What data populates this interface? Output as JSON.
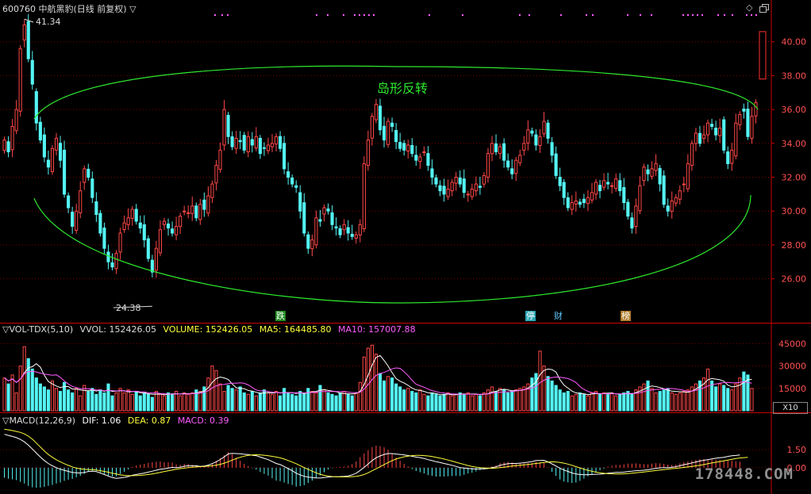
{
  "header": {
    "title": "600760 中航黑豹(日线 前复权) ▽",
    "icon_diamond": "◇",
    "icon_restore": "restore-window"
  },
  "annotation": {
    "text": "岛形反转"
  },
  "price_labels": {
    "high": "41.34",
    "low": "24.38"
  },
  "event_markers": [
    {
      "text": "跌",
      "bg": "#1f8a1f",
      "color": "#ffffff"
    },
    {
      "text": "停",
      "bg": "#2aa5b3",
      "color": "#ffffff"
    },
    {
      "text": "财",
      "bg": "#000000",
      "color": "#5ec8ff"
    },
    {
      "text": "榜",
      "bg": "#b07a28",
      "color": "#ffffff"
    }
  ],
  "volume_panel": {
    "name": "▽VOL-TDX(5,10)",
    "vvol": "VVOL: 152426.05",
    "volume": "VOLUME: 152426.05",
    "ma5": "MA5: 164485.80",
    "ma10": "MA10: 157007.88",
    "scale_button": "X10"
  },
  "macd_panel": {
    "name": "▽MACD(12,26,9)",
    "dif": "DIF: 1.06",
    "dea": "DEA: 0.87",
    "macd": "MACD: 0.39"
  },
  "watermark": "178448.COM",
  "colors": {
    "up": "#ff4747",
    "down": "#54f4f4",
    "ma5": "#ffffff",
    "ma10": "#ff5cff",
    "dif": "#ffffff",
    "dea": "#ffff3c",
    "ellipse": "#2ee82e",
    "grid": "#7a0000",
    "axis": "#cc0000"
  },
  "chart_data": [
    {
      "type": "candlestick",
      "title": "600760 中航黑豹(日线 前复权)",
      "y_ticks": [
        26.0,
        28.0,
        30.0,
        32.0,
        34.0,
        36.0,
        38.0,
        40.0
      ],
      "ylim": [
        23.5,
        42.0
      ],
      "grid": true,
      "marked_high": 41.34,
      "marked_low": 24.38,
      "close": [
        34.2,
        33.5,
        35.0,
        36.0,
        39.6,
        41.0,
        39.0,
        37.5,
        35.2,
        34.2,
        33.2,
        32.6,
        33.7,
        34.3,
        33.0,
        31.0,
        30.2,
        29.1,
        30.0,
        31.2,
        32.5,
        32.0,
        30.8,
        29.8,
        28.7,
        27.8,
        27.0,
        26.7,
        27.5,
        28.7,
        29.3,
        29.6,
        30.1,
        29.4,
        29.0,
        28.3,
        27.2,
        26.4,
        27.8,
        28.9,
        29.4,
        29.0,
        28.7,
        29.1,
        29.7,
        30.0,
        29.9,
        30.3,
        29.6,
        30.4,
        30.1,
        30.9,
        31.6,
        32.7,
        33.6,
        36.0,
        34.4,
        33.8,
        34.3,
        34.1,
        33.6,
        34.4,
        33.9,
        34.4,
        33.4,
        33.7,
        33.9,
        34.0,
        34.4,
        33.7,
        32.5,
        32.0,
        31.6,
        31.4,
        30.0,
        28.7,
        27.8,
        28.3,
        29.6,
        29.4,
        30.2,
        30.0,
        29.2,
        29.0,
        28.6,
        29.2,
        28.7,
        28.5,
        28.6,
        29.2,
        32.8,
        34.2,
        35.6,
        36.3,
        34.8,
        34.2,
        35.3,
        35.0,
        34.1,
        33.7,
        33.6,
        33.9,
        33.4,
        33.0,
        33.2,
        33.5,
        32.7,
        32.0,
        31.6,
        31.2,
        31.0,
        31.3,
        31.7,
        32.0,
        31.6,
        31.1,
        31.0,
        31.3,
        31.6,
        31.4,
        32.1,
        33.4,
        34.0,
        33.5,
        33.8,
        33.0,
        32.6,
        32.2,
        33.0,
        33.3,
        34.0,
        34.8,
        34.6,
        33.9,
        34.4,
        35.3,
        34.3,
        33.3,
        32.1,
        31.5,
        30.8,
        30.2,
        30.5,
        30.6,
        30.4,
        30.5,
        30.8,
        31.1,
        31.7,
        31.2,
        31.8,
        31.6,
        31.5,
        31.9,
        31.2,
        30.5,
        29.7,
        29.0,
        30.3,
        31.5,
        32.6,
        32.2,
        32.5,
        32.8,
        31.6,
        30.4,
        30.0,
        30.6,
        30.8,
        31.2,
        31.6,
        32.8,
        34.0,
        34.6,
        34.0,
        34.5,
        35.2,
        35.0,
        34.5,
        34.9,
        33.6,
        32.8,
        33.6,
        35.2,
        35.7,
        35.9,
        34.4,
        35.6,
        36.4
      ],
      "volume": {
        "y_ticks": [
          15000,
          30000,
          45000
        ],
        "values": [
          22000,
          18000,
          24000,
          12000,
          30000,
          43000,
          35000,
          28000,
          22000,
          18000,
          16000,
          14000,
          20000,
          15000,
          13000,
          19000,
          14000,
          12000,
          15000,
          10000,
          17000,
          13000,
          15000,
          11000,
          14000,
          12000,
          18000,
          10000,
          12000,
          15000,
          12000,
          14000,
          11000,
          13000,
          10000,
          12000,
          11000,
          9000,
          13000,
          11000,
          10000,
          12000,
          11000,
          13000,
          10000,
          12000,
          11000,
          12000,
          14000,
          13000,
          16000,
          22000,
          30000,
          27000,
          18000,
          13000,
          17000,
          15000,
          14000,
          16000,
          12000,
          11000,
          13000,
          10000,
          12000,
          14000,
          12000,
          11000,
          13000,
          10000,
          15000,
          12000,
          11000,
          10000,
          13000,
          12000,
          15000,
          13000,
          12000,
          17000,
          14000,
          12000,
          11000,
          10000,
          12000,
          13000,
          11000,
          10000,
          12000,
          19000,
          36000,
          42000,
          44000,
          38000,
          25000,
          20000,
          23000,
          22000,
          18000,
          16000,
          14000,
          15000,
          13000,
          12000,
          14000,
          11000,
          10000,
          12000,
          11000,
          10000,
          11000,
          12000,
          10000,
          11000,
          12000,
          11000,
          12000,
          10000,
          11000,
          10000,
          12000,
          14000,
          16000,
          13000,
          15000,
          14000,
          12000,
          13000,
          14000,
          15000,
          16000,
          18000,
          22000,
          25000,
          40000,
          30000,
          23000,
          20000,
          17000,
          14000,
          12000,
          13000,
          10000,
          11000,
          12000,
          11000,
          10000,
          12000,
          13000,
          11000,
          12000,
          11000,
          12000,
          10000,
          11000,
          12000,
          13000,
          11000,
          14000,
          16000,
          18000,
          20000,
          15000,
          12000,
          13000,
          14000,
          15000,
          12000,
          11000,
          12000,
          13000,
          14000,
          16000,
          18000,
          20000,
          22000,
          28000,
          20000,
          16000,
          18000,
          17000,
          15000,
          14000,
          18000,
          22000,
          26000,
          24000,
          15000
        ]
      },
      "macd": {
        "y_ticks": [
          0.0,
          1.5
        ],
        "dif": [
          2.79,
          2.7,
          2.61,
          2.51,
          2.36,
          2.16,
          1.88,
          1.56,
          1.22,
          0.89,
          0.6,
          0.35,
          0.15,
          0.0,
          -0.13,
          -0.22,
          -0.31,
          -0.4,
          -0.43,
          -0.44,
          -0.4,
          -0.32,
          -0.29,
          -0.33,
          -0.44,
          -0.57,
          -0.7,
          -0.83,
          -0.89,
          -0.86,
          -0.81,
          -0.74,
          -0.63,
          -0.57,
          -0.51,
          -0.45,
          -0.37,
          -0.29,
          -0.21,
          -0.13,
          -0.09,
          -0.03,
          0.02,
          0.01,
          0.04,
          0.12,
          0.16,
          0.16,
          0.16,
          0.11,
          0.14,
          0.21,
          0.34,
          0.49,
          0.68,
          0.9,
          1.15,
          1.19,
          1.18,
          1.16,
          1.12,
          1.1,
          1.04,
          1.0,
          0.89,
          0.78,
          0.67,
          0.51,
          0.35,
          0.26,
          0.1,
          -0.08,
          -0.25,
          -0.46,
          -0.6,
          -0.72,
          -0.78,
          -0.83,
          -0.86,
          -0.87,
          -0.83,
          -0.78,
          -0.76,
          -0.75,
          -0.74,
          -0.72,
          -0.69,
          -0.6,
          -0.46,
          -0.23,
          0.03,
          0.3,
          0.6,
          0.83,
          0.98,
          1.11,
          1.18,
          1.18,
          1.14,
          1.11,
          1.07,
          1.02,
          0.95,
          0.89,
          0.84,
          0.77,
          0.67,
          0.59,
          0.5,
          0.43,
          0.35,
          0.28,
          0.2,
          0.11,
          0.01,
          -0.03,
          -0.06,
          -0.1,
          -0.11,
          -0.1,
          -0.09,
          -0.07,
          0.01,
          0.07,
          0.19,
          0.27,
          0.34,
          0.35,
          0.35,
          0.38,
          0.41,
          0.46,
          0.51,
          0.6,
          0.61,
          0.62,
          0.49,
          0.32,
          0.14,
          -0.05,
          -0.2,
          -0.31,
          -0.44,
          -0.53,
          -0.57,
          -0.59,
          -0.58,
          -0.57,
          -0.55,
          -0.54,
          -0.51,
          -0.46,
          -0.43,
          -0.4,
          -0.4,
          -0.37,
          -0.32,
          -0.29,
          -0.25,
          -0.24,
          -0.21,
          -0.18,
          -0.11,
          -0.05,
          -0.02,
          0.0,
          0.01,
          0.04,
          0.08,
          0.16,
          0.25,
          0.32,
          0.4,
          0.48,
          0.56,
          0.62,
          0.67,
          0.73,
          0.79,
          0.83,
          0.87,
          0.94,
          1.0,
          1.02,
          1.06
        ],
        "dea": [
          3.21,
          3.16,
          3.1,
          3.03,
          2.95,
          2.82,
          2.64,
          2.38,
          2.06,
          1.72,
          1.4,
          1.11,
          0.87,
          0.66,
          0.49,
          0.33,
          0.19,
          0.07,
          -0.03,
          -0.1,
          -0.14,
          -0.15,
          -0.17,
          -0.2,
          -0.25,
          -0.31,
          -0.38,
          -0.46,
          -0.53,
          -0.6,
          -0.64,
          -0.67,
          -0.67,
          -0.66,
          -0.64,
          -0.61,
          -0.57,
          -0.52,
          -0.46,
          -0.39,
          -0.32,
          -0.26,
          -0.19,
          -0.13,
          -0.08,
          -0.04,
          0.0,
          0.04,
          0.06,
          0.09,
          0.1,
          0.13,
          0.16,
          0.21,
          0.28,
          0.38,
          0.5,
          0.63,
          0.76,
          0.87,
          0.96,
          1.03,
          1.06,
          1.08,
          1.07,
          1.04,
          1.0,
          0.95,
          0.89,
          0.82,
          0.72,
          0.6,
          0.47,
          0.33,
          0.17,
          0.01,
          -0.14,
          -0.29,
          -0.43,
          -0.55,
          -0.64,
          -0.7,
          -0.74,
          -0.76,
          -0.77,
          -0.77,
          -0.77,
          -0.75,
          -0.72,
          -0.67,
          -0.57,
          -0.43,
          -0.26,
          -0.09,
          0.08,
          0.26,
          0.43,
          0.59,
          0.72,
          0.82,
          0.91,
          0.97,
          1.01,
          1.03,
          1.03,
          1.01,
          0.98,
          0.93,
          0.87,
          0.8,
          0.72,
          0.64,
          0.55,
          0.45,
          0.36,
          0.27,
          0.18,
          0.11,
          0.05,
          0.01,
          -0.02,
          -0.04,
          -0.05,
          -0.03,
          0.0,
          0.04,
          0.09,
          0.13,
          0.17,
          0.2,
          0.24,
          0.27,
          0.31,
          0.35,
          0.39,
          0.43,
          0.47,
          0.49,
          0.48,
          0.44,
          0.38,
          0.3,
          0.2,
          0.09,
          -0.02,
          -0.13,
          -0.22,
          -0.3,
          -0.38,
          -0.43,
          -0.47,
          -0.5,
          -0.51,
          -0.52,
          -0.52,
          -0.51,
          -0.49,
          -0.46,
          -0.43,
          -0.4,
          -0.36,
          -0.32,
          -0.28,
          -0.24,
          -0.2,
          -0.16,
          -0.12,
          -0.08,
          -0.05,
          -0.02,
          0.02,
          0.06,
          0.1,
          0.15,
          0.2,
          0.26,
          0.33,
          0.39,
          0.45,
          0.51,
          0.58,
          0.64,
          0.7,
          0.76,
          0.81,
          0.84,
          0.87
        ]
      }
    }
  ]
}
